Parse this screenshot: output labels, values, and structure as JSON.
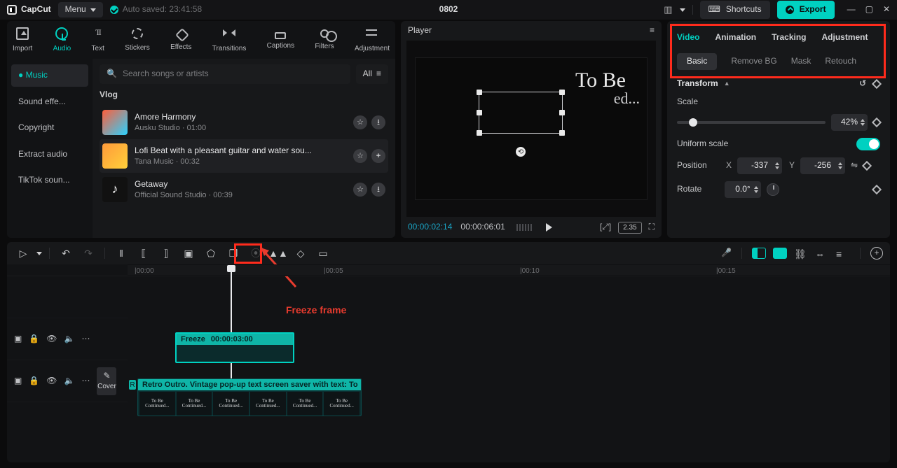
{
  "title": "0802",
  "brand": "CapCut",
  "menu_label": "Menu",
  "autosave": "Auto saved: 23:41:58",
  "shortcuts_label": "Shortcuts",
  "export_label": "Export",
  "lib_tabs": [
    "Import",
    "Audio",
    "Text",
    "Stickers",
    "Effects",
    "Transitions",
    "Captions",
    "Filters",
    "Adjustment"
  ],
  "lib_side": {
    "items": [
      "Music",
      "Sound effe...",
      "Copyright",
      "Extract audio",
      "TikTok soun..."
    ]
  },
  "search_placeholder": "Search songs or artists",
  "all_label": "All",
  "category": "Vlog",
  "songs": [
    {
      "title": "Amore Harmony",
      "sub": "Ausku Studio · 01:00"
    },
    {
      "title": "Lofi Beat with a pleasant guitar and water sou...",
      "sub": "Tana Music · 00:32"
    },
    {
      "title": "Getaway",
      "sub": "Official Sound Studio · 00:39"
    }
  ],
  "player": {
    "header": "Player",
    "time_current": "00:00:02:14",
    "time_total": "00:00:06:01",
    "ratio": "2.35",
    "text1": "To Be",
    "text2": "ed..."
  },
  "props": {
    "tabs": [
      "Video",
      "Animation",
      "Tracking",
      "Adjustment"
    ],
    "subtabs": [
      "Basic",
      "Remove BG",
      "Mask",
      "Retouch"
    ],
    "section_transform": "Transform",
    "scale": {
      "label": "Scale",
      "value": "42%"
    },
    "uniform": {
      "label": "Uniform scale"
    },
    "position": {
      "label": "Position",
      "x": "-337",
      "y": "-256"
    },
    "rotate": {
      "label": "Rotate",
      "value": "0.0°"
    }
  },
  "timeline": {
    "ruler": [
      "00:00",
      "00:05",
      "00:10",
      "00:15"
    ],
    "freeze_head": {
      "label": "Freeze",
      "time": "00:00:03:00"
    },
    "video_head": "Retro Outro. Vintage pop-up text screen saver with text: To",
    "marker": "R",
    "cover_label": "Cover",
    "thumb_line1": "To Be",
    "thumb_line2": "Continued..."
  },
  "annotation": {
    "label": "Freeze frame"
  }
}
